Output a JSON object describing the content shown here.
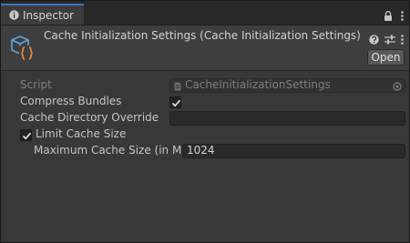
{
  "tab": {
    "title": "Inspector",
    "icon": "info-icon"
  },
  "tab_icons": [
    "lock-icon",
    "more-vertical-icon"
  ],
  "header": {
    "title": "Cache Initialization Settings (Cache Initialization Settings)",
    "asset_icon": "scriptable-object-icon",
    "icons": [
      "help-icon",
      "settings-sliders-icon",
      "more-vertical-icon"
    ],
    "open_label": "Open"
  },
  "properties": {
    "script": {
      "label": "Script",
      "value": "CacheInitializationSettings",
      "enabled": false
    },
    "compress_bundles": {
      "label": "Compress Bundles",
      "checked": true
    },
    "cache_directory_override": {
      "label": "Cache Directory Override",
      "value": ""
    },
    "limit_cache_size": {
      "label": "Limit Cache Size",
      "checked": true
    },
    "maximum_cache_size": {
      "label": "Maximum Cache Size (in MB)",
      "value": "1024"
    }
  },
  "colors": {
    "accent": "#3a79bb",
    "window_bg": "#383838",
    "header_bg": "#3e3e3e",
    "field_bg": "#2a2a2a",
    "text": "#c4c4c4",
    "icon_orange": "#e08c3a"
  }
}
